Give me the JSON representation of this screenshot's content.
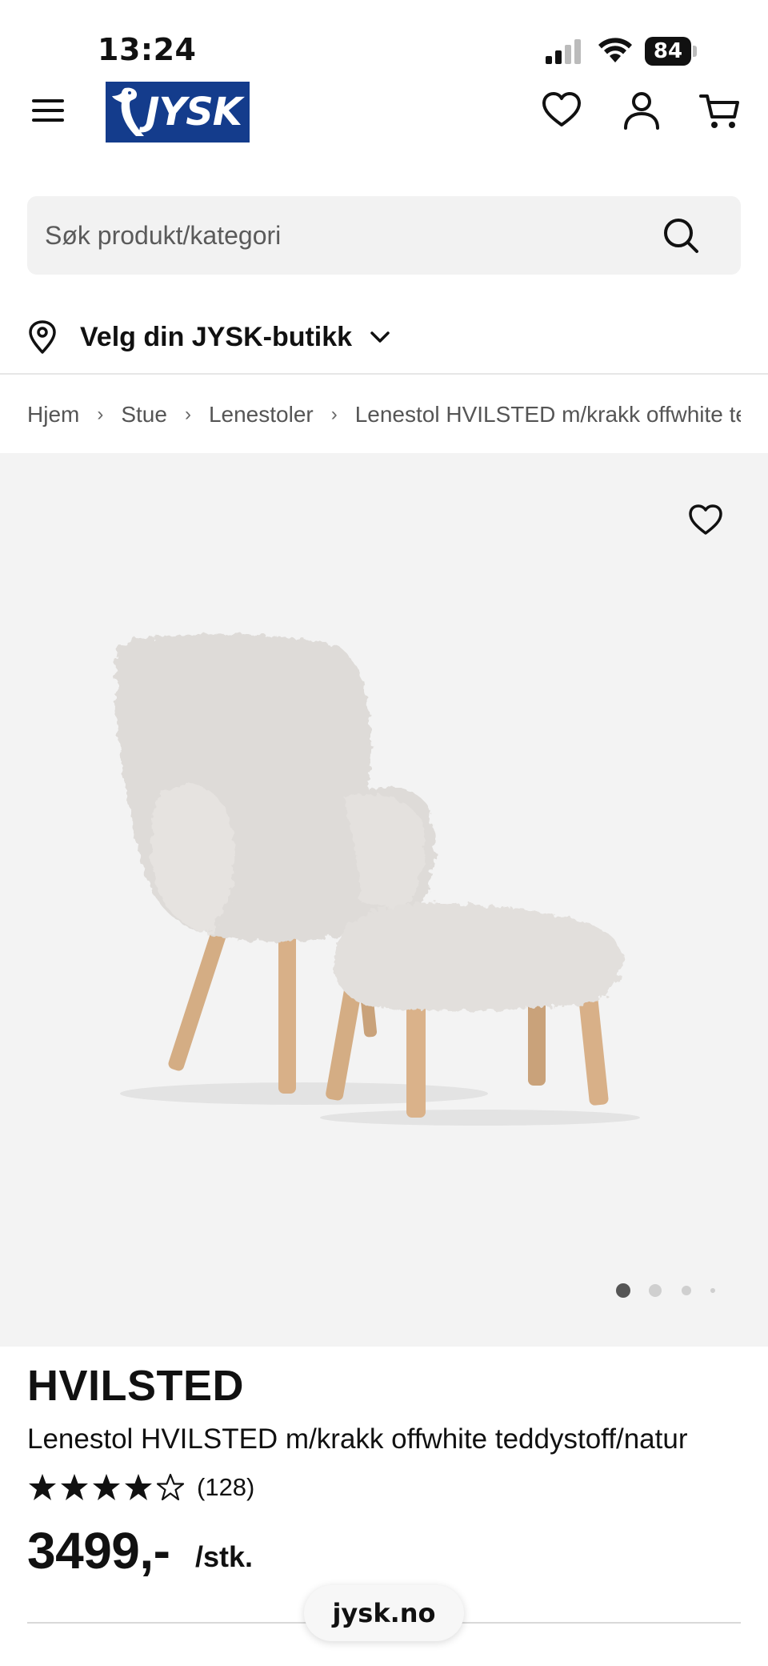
{
  "status_bar": {
    "time": "13:24",
    "battery": "84"
  },
  "header": {
    "logo_text": "JYSK",
    "brand_color": "#143c8c"
  },
  "search": {
    "placeholder": "Søk produkt/kategori"
  },
  "store": {
    "label": "Velg din JYSK-butikk"
  },
  "breadcrumb": [
    "Hjem",
    "Stue",
    "Lenestoler",
    "Lenestol HVILSTED m/krakk offwhite teddystoff/natur"
  ],
  "gallery": {
    "image_count": 4,
    "active_index": 0
  },
  "product": {
    "brand": "HVILSTED",
    "name": "Lenestol HVILSTED m/krakk offwhite teddystoff/natur",
    "rating": 4,
    "rating_max": 5,
    "review_count": "(128)",
    "price": "3499,-",
    "unit": "/stk."
  },
  "browser": {
    "url": "jysk.no"
  }
}
